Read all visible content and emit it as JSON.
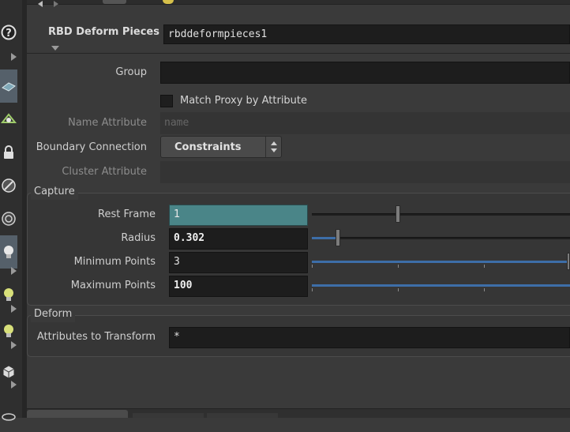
{
  "header": {
    "node_type_label": "RBD Deform Pieces",
    "node_name": "rbddeformpieces1"
  },
  "params": {
    "group_label": "Group",
    "group_value": "",
    "match_proxy_label": "Match Proxy by Attribute",
    "match_proxy_checked": false,
    "name_attr_label": "Name Attribute",
    "name_attr_value": "name",
    "boundary_label": "Boundary Connection",
    "boundary_value": "Constraints",
    "cluster_attr_label": "Cluster Attribute",
    "cluster_attr_value": ""
  },
  "capture": {
    "title": "Capture",
    "rest_frame_label": "Rest Frame",
    "rest_frame_value": "1",
    "radius_label": "Radius",
    "radius_value": "0.302",
    "min_points_label": "Minimum Points",
    "min_points_value": "3",
    "max_points_label": "Maximum Points",
    "max_points_value": "100"
  },
  "deform": {
    "title": "Deform",
    "attrs_label": "Attributes to Transform",
    "attrs_value": "*"
  },
  "toolbar": {
    "icons": [
      "help-icon",
      "geometry-icon",
      "display-icon",
      "lock-icon",
      "visibility-icon",
      "camera-icon",
      "light-icon",
      "light-add-icon",
      "light-link-icon",
      "box-icon"
    ]
  },
  "colors": {
    "accent_blue": "#3d6ea8",
    "rest_frame_field": "#4a8588"
  }
}
